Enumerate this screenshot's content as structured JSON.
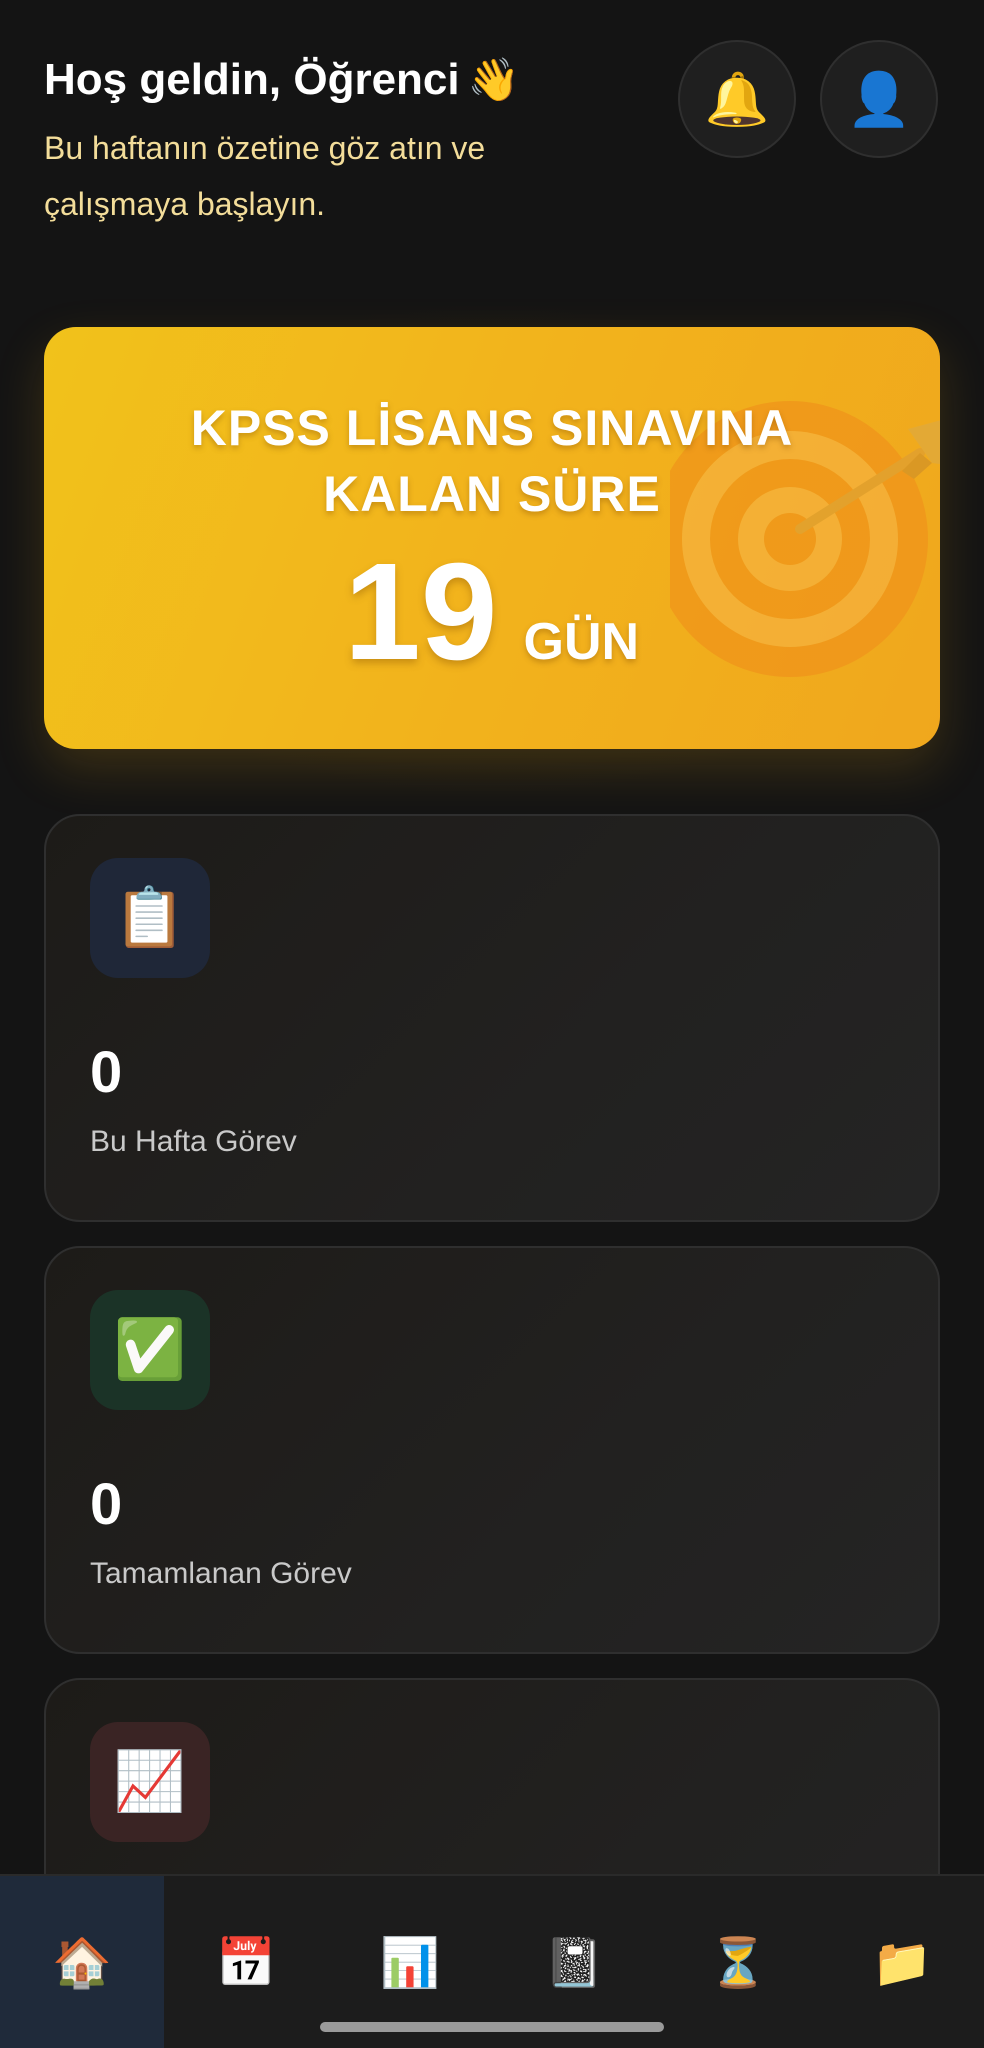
{
  "header": {
    "greeting": "Hoş geldin, Öğrenci",
    "greeting_emoji": "👋",
    "subtitle": "Bu haftanın özetine göz atın ve çalışmaya başlayın.",
    "notifications_icon": "🔔",
    "profile_icon": "👤"
  },
  "countdown": {
    "title_line1": "KPSS LİSANS SINAVINA",
    "title_line2": "KALAN SÜRE",
    "days": "19",
    "unit": "GÜN",
    "icon": "target-dart-icon",
    "accent_color": "#f2b31c"
  },
  "stats": [
    {
      "icon": "📋",
      "icon_name": "clipboard-icon",
      "value": "0",
      "label": "Bu Hafta Görev"
    },
    {
      "icon": "✅",
      "icon_name": "check-mark-icon",
      "value": "0",
      "label": "Tamamlanan Görev"
    },
    {
      "icon": "📈",
      "icon_name": "chart-increasing-icon"
    }
  ],
  "nav": {
    "items": [
      {
        "icon": "🏠",
        "name": "home-icon",
        "active": true
      },
      {
        "icon": "📅",
        "name": "calendar-icon",
        "active": false
      },
      {
        "icon": "📊",
        "name": "bar-chart-icon",
        "active": false
      },
      {
        "icon": "📓",
        "name": "notebook-icon",
        "active": false
      },
      {
        "icon": "⏳",
        "name": "hourglass-icon",
        "active": false
      },
      {
        "icon": "📁",
        "name": "folder-icon",
        "active": false
      }
    ]
  }
}
